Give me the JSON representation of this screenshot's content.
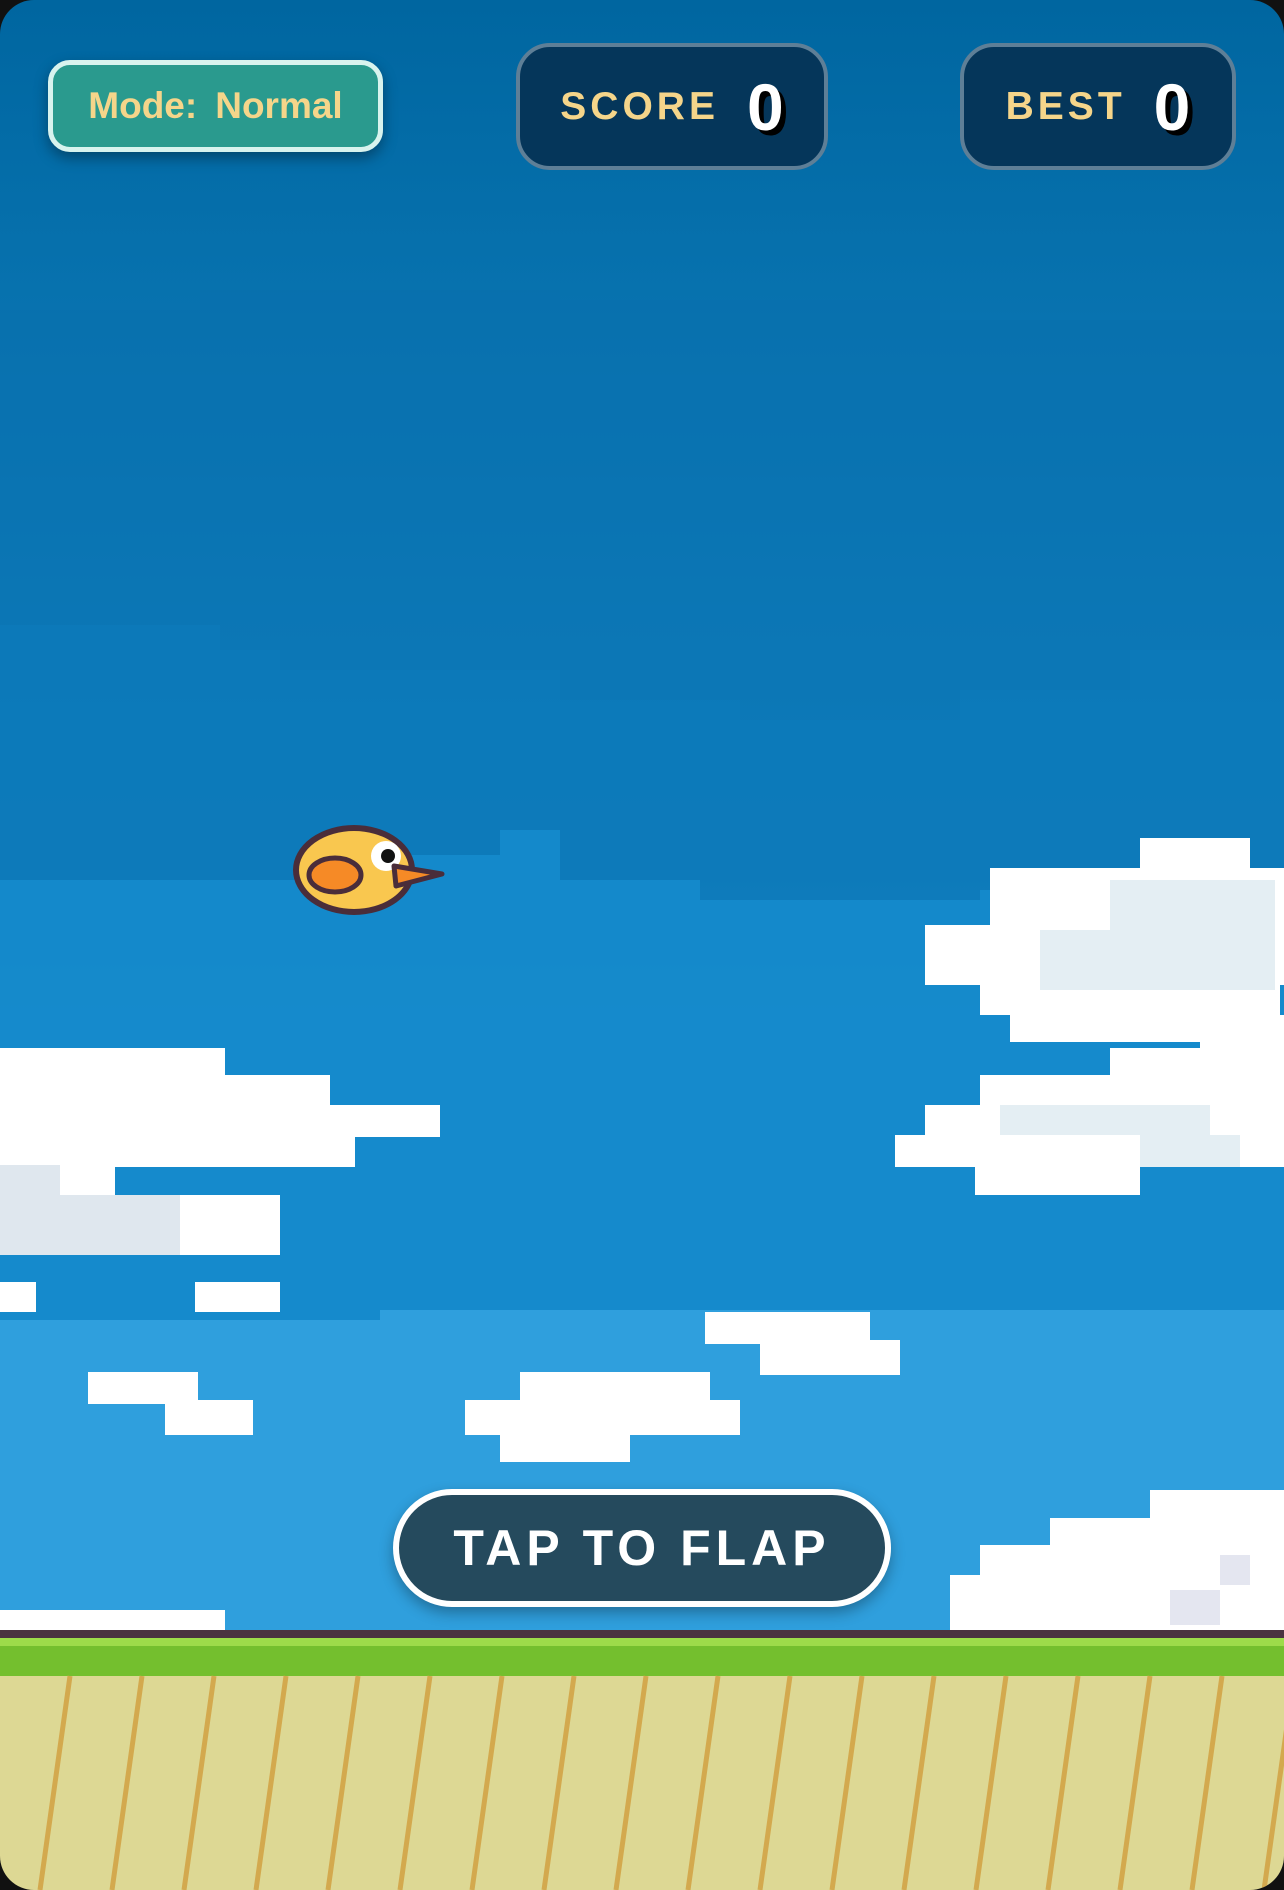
{
  "hud": {
    "mode_label": "Mode:",
    "mode_value": "Normal",
    "score_label": "SCORE",
    "score_value": "0",
    "best_label": "BEST",
    "best_value": "0"
  },
  "prompt": {
    "tap_label": "TAP TO FLAP"
  },
  "icons": {
    "player": "bird-icon",
    "background": "pixel-clouds"
  },
  "colors": {
    "sky_top": "#0068a2",
    "sky_bottom": "#5cbff0",
    "cloud": "#ffffff",
    "grass": "#74bf2e",
    "dirt": "#ddd894",
    "bird_body": "#f9c74f",
    "accent": "#f5d58a"
  }
}
